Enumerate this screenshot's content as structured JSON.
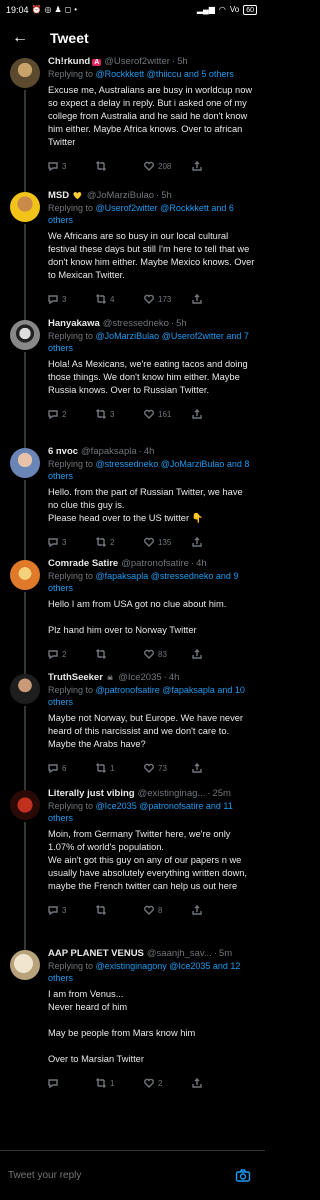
{
  "status_bar": {
    "time": "19:04",
    "battery": "60"
  },
  "header": {
    "title": "Tweet"
  },
  "tweets": [
    {
      "name": "Ch!rkund",
      "badge": "A",
      "handle": "@Userof2witter",
      "time": "5h",
      "replying_prefix": "Replying to ",
      "replying_to": "@Rockkkett @thiiccu and 5 others",
      "text": "Excuse me, Australians are busy in worldcup now so expect a delay in reply. But i asked one of my college from Australia and he said he don't know him either. Maybe Africa knows. Over to african Twitter",
      "replies": "3",
      "retweets": "",
      "likes": "208"
    },
    {
      "name": "MSD",
      "badge": "💛",
      "handle": "@JoMarziBulao",
      "time": "5h",
      "replying_prefix": "Replying to ",
      "replying_to": "@Userof2witter @Rockkkett and 6 others",
      "text": "We Africans are so busy in our local cultural festival these days but still I'm here to tell that we don't know him either. Maybe Mexico knows. Over to Mexican Twitter.",
      "replies": "3",
      "retweets": "4",
      "likes": "173"
    },
    {
      "name": "Hanyakawa",
      "badge": "",
      "handle": "@stressedneko",
      "time": "5h",
      "replying_prefix": "Replying to ",
      "replying_to": "@JoMarziBulao @Userof2witter and 7 others",
      "text": "Hola! As Mexicans, we're eating tacos and doing those things. We don't know him either. Maybe Russia knows. Over to Russian Twitter.",
      "replies": "2",
      "retweets": "3",
      "likes": "161"
    },
    {
      "name": "6 пvoc",
      "badge": "",
      "handle": "@fapaksapla",
      "time": "4h",
      "replying_prefix": "Replying to ",
      "replying_to": "@stressedneko @JoMarziBulao and 8 others",
      "text": "Hello. from the part of Russian Twitter, we have no clue this guy is.\nPlease head over to the US twitter 👇",
      "replies": "3",
      "retweets": "2",
      "likes": "135"
    },
    {
      "name": "Comrade Satire",
      "badge": "",
      "handle": "@patronofsatire",
      "time": "4h",
      "replying_prefix": "Replying to ",
      "replying_to": "@fapaksapla @stressedneko and 9 others",
      "text": "Hello I am from USA got no clue about him.\n\nPlz hand him over to Norway Twitter",
      "replies": "2",
      "retweets": "",
      "likes": "83"
    },
    {
      "name": "TruthSeeker",
      "badge": "☠",
      "handle": "@Ice2035",
      "time": "4h",
      "replying_prefix": "Replying to ",
      "replying_to": "@patronofsatire @fapaksapla and 10 others",
      "text": "Maybe not Norway, but Europe. We have never heard of this narcissist and we don't care to. Maybe the Arabs have?",
      "replies": "6",
      "retweets": "1",
      "likes": "73"
    },
    {
      "name": "Literally just vibing",
      "badge": "",
      "handle": "@existinginag...",
      "time": "25m",
      "replying_prefix": "Replying to ",
      "replying_to": "@Ice2035 @patronofsatire and 11 others",
      "text": "Moin, from Germany Twitter here, we're only 1.07% of world's population.\nWe ain't got this guy on any of our papers n we usually have absolutely everything written down, maybe the French twitter can help us out here",
      "replies": "3",
      "retweets": "",
      "likes": "8"
    },
    {
      "name": "AAP PLANET VENUS",
      "badge": "",
      "handle": "@saanjh_sav...",
      "time": "5m",
      "replying_prefix": "Replying to ",
      "replying_to": "@existinginagony @Ice2035 and 12 others",
      "text": "I am from Venus...\nNever heard of him\n\nMay be people from Mars know him\n\nOver to Marsian Twitter",
      "replies": "",
      "retweets": "1",
      "likes": "2"
    }
  ],
  "compose": {
    "placeholder": "Tweet your reply"
  },
  "icons": {
    "back": "arrow-left-icon",
    "reply": "reply-icon",
    "retweet": "retweet-icon",
    "like": "heart-icon",
    "share": "share-icon",
    "camera": "camera-icon"
  },
  "colors": {
    "background": "#000000",
    "link": "#1d9bf0",
    "muted": "#71767b",
    "text": "#e7e9ea",
    "badge_red": "#e0245e"
  }
}
